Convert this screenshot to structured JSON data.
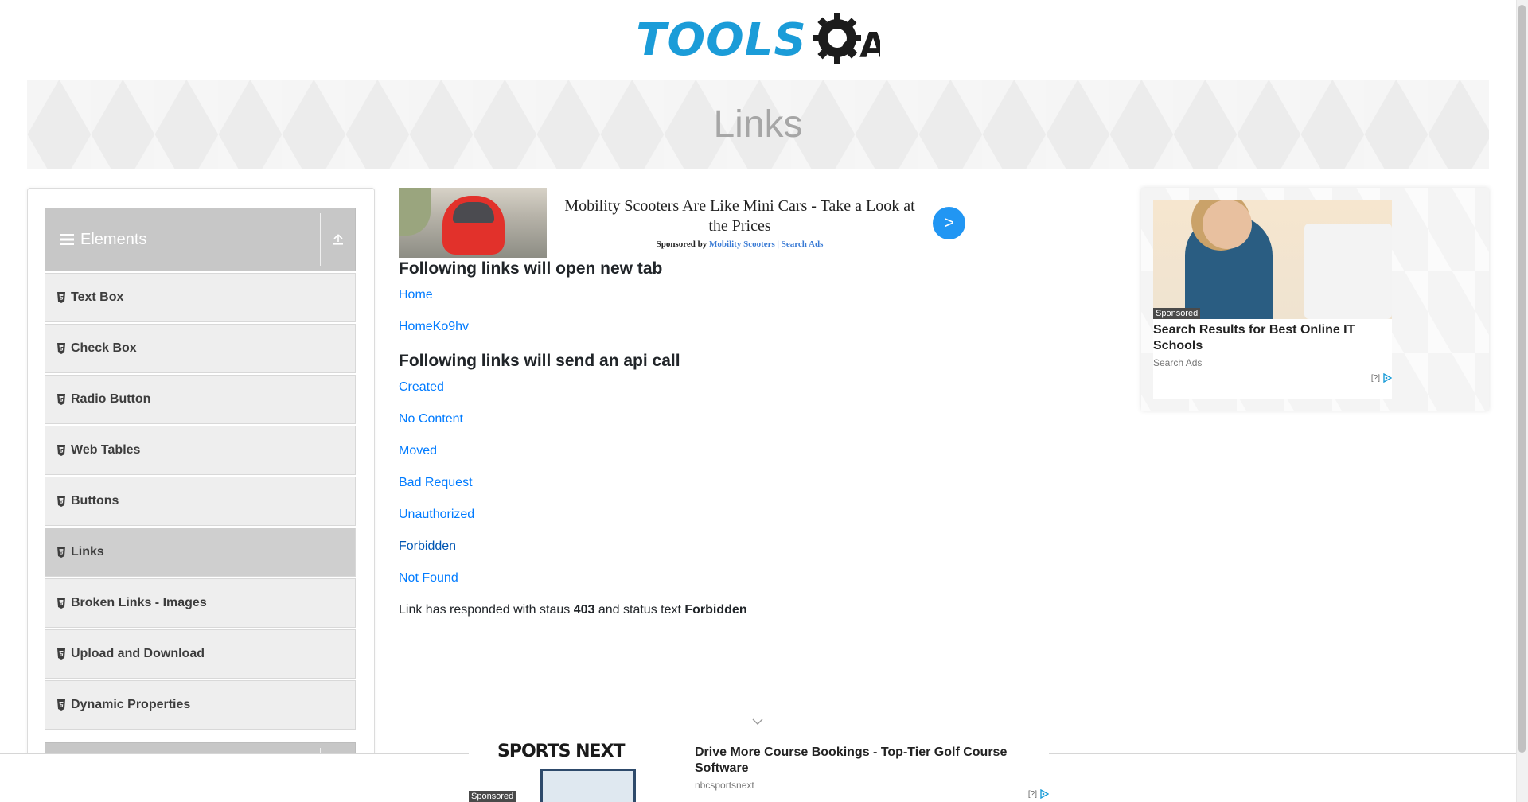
{
  "header": {
    "logo_text": "TOOLS",
    "logo_suffix": "A",
    "page_title": "Links"
  },
  "sidebar": {
    "group_label": "Elements",
    "items": [
      {
        "label": "Text Box",
        "active": false
      },
      {
        "label": "Check Box",
        "active": false
      },
      {
        "label": "Radio Button",
        "active": false
      },
      {
        "label": "Web Tables",
        "active": false
      },
      {
        "label": "Buttons",
        "active": false
      },
      {
        "label": "Links",
        "active": true
      },
      {
        "label": "Broken Links - Images",
        "active": false
      },
      {
        "label": "Upload and Download",
        "active": false
      },
      {
        "label": "Dynamic Properties",
        "active": false
      }
    ]
  },
  "ad_top": {
    "title": "Mobility Scooters Are Like Mini Cars - Take a Look at the Prices",
    "sponsored_by": "Sponsored by",
    "sponsor": "Mobility Scooters | Search Ads",
    "arrow": ">"
  },
  "content": {
    "new_tab_heading": "Following links will open new tab",
    "new_tab_links": [
      "Home",
      "HomeKo9hv"
    ],
    "api_heading": "Following links will send an api call",
    "api_links": [
      "Created",
      "No Content",
      "Moved",
      "Bad Request",
      "Unauthorized",
      "Forbidden",
      "Not Found"
    ],
    "visited_link": "Forbidden",
    "response": {
      "prefix": "Link has responded with staus",
      "status_code": "403",
      "middle": "and status text",
      "status_text": "Forbidden"
    }
  },
  "ad_right": {
    "badge": "Sponsored",
    "title": "Search Results for Best Online IT Schools",
    "source": "Search Ads",
    "help": "[?]"
  },
  "ad_bottom": {
    "badge": "Sponsored",
    "logo": "SPORTS NEXT",
    "title": "Drive More Course Bookings - Top-Tier Golf Course Software",
    "source": "nbcsportsnext",
    "help": "[?]"
  },
  "colors": {
    "link": "#007bff",
    "logo_blue": "#1b9cd8",
    "arrow_button": "#2196f3"
  }
}
